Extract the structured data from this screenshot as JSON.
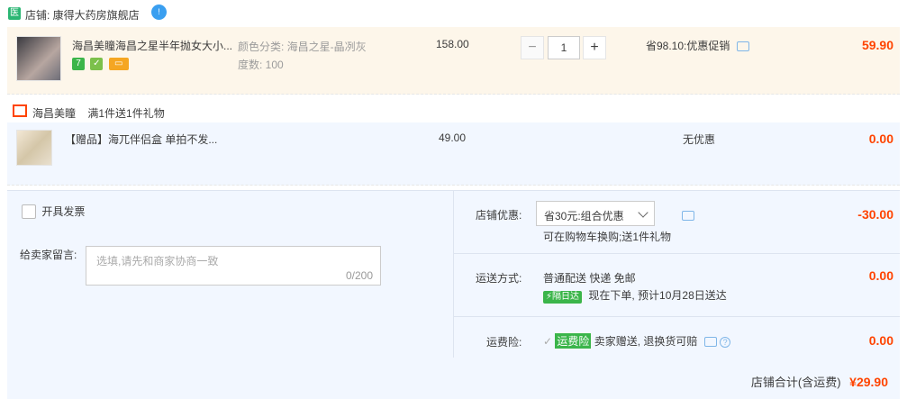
{
  "shop": {
    "badge": "医",
    "name": "店铺: 康得大药房旗舰店",
    "ww_badge": "!"
  },
  "item1": {
    "title": "海昌美瞳海昌之星半年抛女大小...",
    "tags": [
      "7",
      "",
      ""
    ],
    "sku_color": "颜色分类: 海昌之星-晶冽灰",
    "sku_degree": "度数: 100",
    "unit_price": "158.00",
    "qty": "1",
    "qty_minus": "−",
    "qty_plus": "+",
    "promo": "省98.10:优惠促销",
    "subtotal": "59.90"
  },
  "gift_section": {
    "brand": "海昌美瞳",
    "rule": "满1件送1件礼物"
  },
  "item2": {
    "title": "【赠品】海兀伴侣盒 单拍不发...",
    "unit_price": "49.00",
    "promo": "无优惠",
    "subtotal": "0.00"
  },
  "invoice": {
    "label": "开具发票"
  },
  "message": {
    "label": "给卖家留言:",
    "placeholder": "选填,请先和商家协商一致",
    "counter": "0/200"
  },
  "shop_discount": {
    "label": "店铺优惠:",
    "selected": "省30元:组合优惠",
    "note": "可在购物车换购;送1件礼物",
    "amount": "-30.00"
  },
  "shipping": {
    "label": "运送方式:",
    "method": "普通配送 快递 免邮",
    "badge": "隔日达",
    "eta": "现在下单, 预计10月28日送达",
    "amount": "0.00"
  },
  "insurance": {
    "label": "运费险:",
    "badge": "运费险",
    "text": "卖家赠送, 退换货可赔",
    "amount": "0.00"
  },
  "footer": {
    "label": "店铺合计(含运费)",
    "total": "¥29.90"
  },
  "colors": {
    "accent": "#ff4400",
    "green": "#3bb54a",
    "panel": "#f2f7ff",
    "item_bg": "#fdf6ea"
  }
}
